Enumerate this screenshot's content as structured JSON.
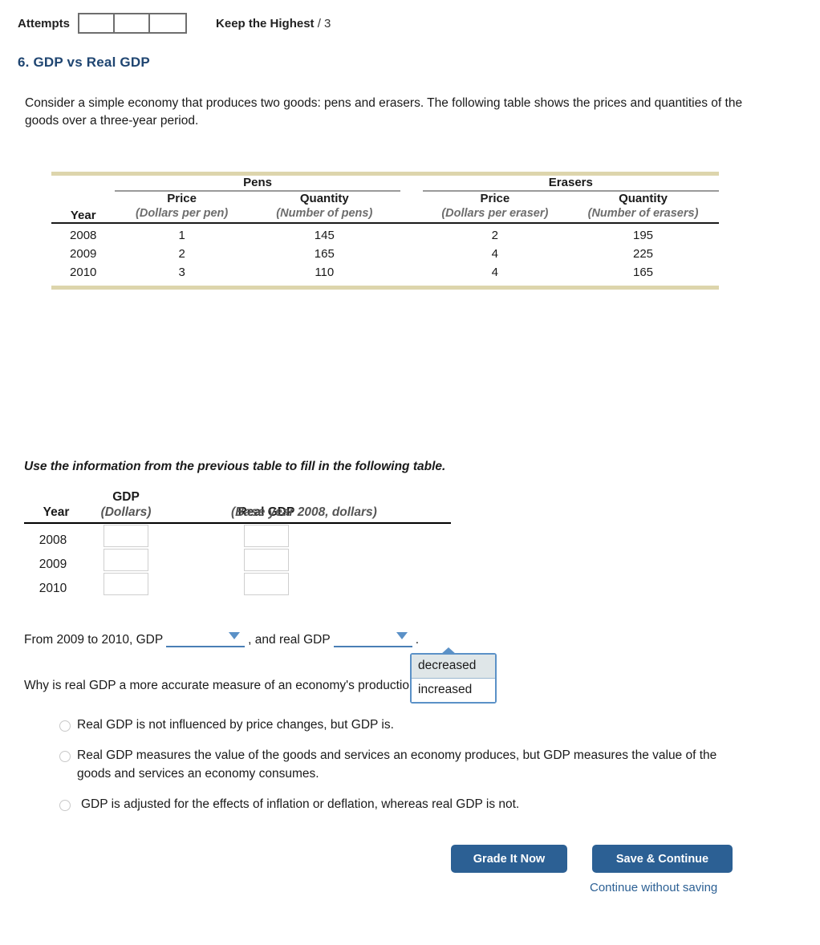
{
  "header": {
    "attempts_label": "Attempts",
    "attempt_boxes": [
      "",
      "",
      ""
    ],
    "keep_highest_label": "Keep the Highest",
    "keep_highest_value": "/ 3"
  },
  "question": {
    "heading": "6. GDP vs Real GDP",
    "intro": "Consider a simple economy that produces two goods: pens and erasers. The following table shows the prices and quantities of the goods over a three-year period."
  },
  "table1": {
    "group_headers": [
      "Pens",
      "Erasers"
    ],
    "year_header": "Year",
    "column_headers": [
      {
        "title": "Price",
        "unit": "(Dollars per pen)"
      },
      {
        "title": "Quantity",
        "unit": "(Number of pens)"
      },
      {
        "title": "Price",
        "unit": "(Dollars per eraser)"
      },
      {
        "title": "Quantity",
        "unit": "(Number of erasers)"
      }
    ],
    "rows": [
      {
        "year": "2008",
        "pen_price": "1",
        "pen_qty": "145",
        "eraser_price": "2",
        "eraser_qty": "195"
      },
      {
        "year": "2009",
        "pen_price": "2",
        "pen_qty": "165",
        "eraser_price": "4",
        "eraser_qty": "225"
      },
      {
        "year": "2010",
        "pen_price": "3",
        "pen_qty": "110",
        "eraser_price": "4",
        "eraser_qty": "165"
      }
    ]
  },
  "fill_instruction": "Use the information from the previous table to fill in the following table.",
  "table2": {
    "year_header": "Year",
    "gdp_header": "GDP",
    "gdp_sub": "(Dollars)",
    "real_gdp_header": "Real GDP",
    "real_gdp_sub": "(Base year 2008, dollars)",
    "rows": [
      {
        "year": "2008",
        "gdp": "",
        "real_gdp": ""
      },
      {
        "year": "2009",
        "gdp": "",
        "real_gdp": ""
      },
      {
        "year": "2010",
        "gdp": "",
        "real_gdp": ""
      }
    ]
  },
  "sentence": {
    "part1": "From 2009 to 2010, GDP",
    "gdp_dropdown_value": "",
    "part2": ", and real GDP",
    "real_gdp_dropdown_value": "",
    "part3": "."
  },
  "dropdown": {
    "open": true,
    "options": [
      "decreased",
      "increased"
    ],
    "selected": "decreased"
  },
  "why_question": "Why is real GDP a more accurate measure of an economy's production than GDP?",
  "answer_options": [
    {
      "text": "Real GDP is not influenced by price changes, but GDP is.",
      "selected": false
    },
    {
      "text": "Real GDP measures the value of the goods and services an economy produces, but GDP measures the value of the goods and services an economy consumes.",
      "selected": false
    },
    {
      "text": "GDP is adjusted for the effects of inflation or deflation, whereas real GDP is not.",
      "selected": false
    }
  ],
  "footer": {
    "grade_button": "Grade It Now",
    "save_button": "Save & Continue",
    "continue_link": "Continue without saving"
  },
  "colors": {
    "heading": "#1f4571",
    "button": "#2c6094",
    "table_rule": "#ddd5ac",
    "dropdown_border": "#5b91c7",
    "dropdown_highlight": "#dfe6e8"
  }
}
